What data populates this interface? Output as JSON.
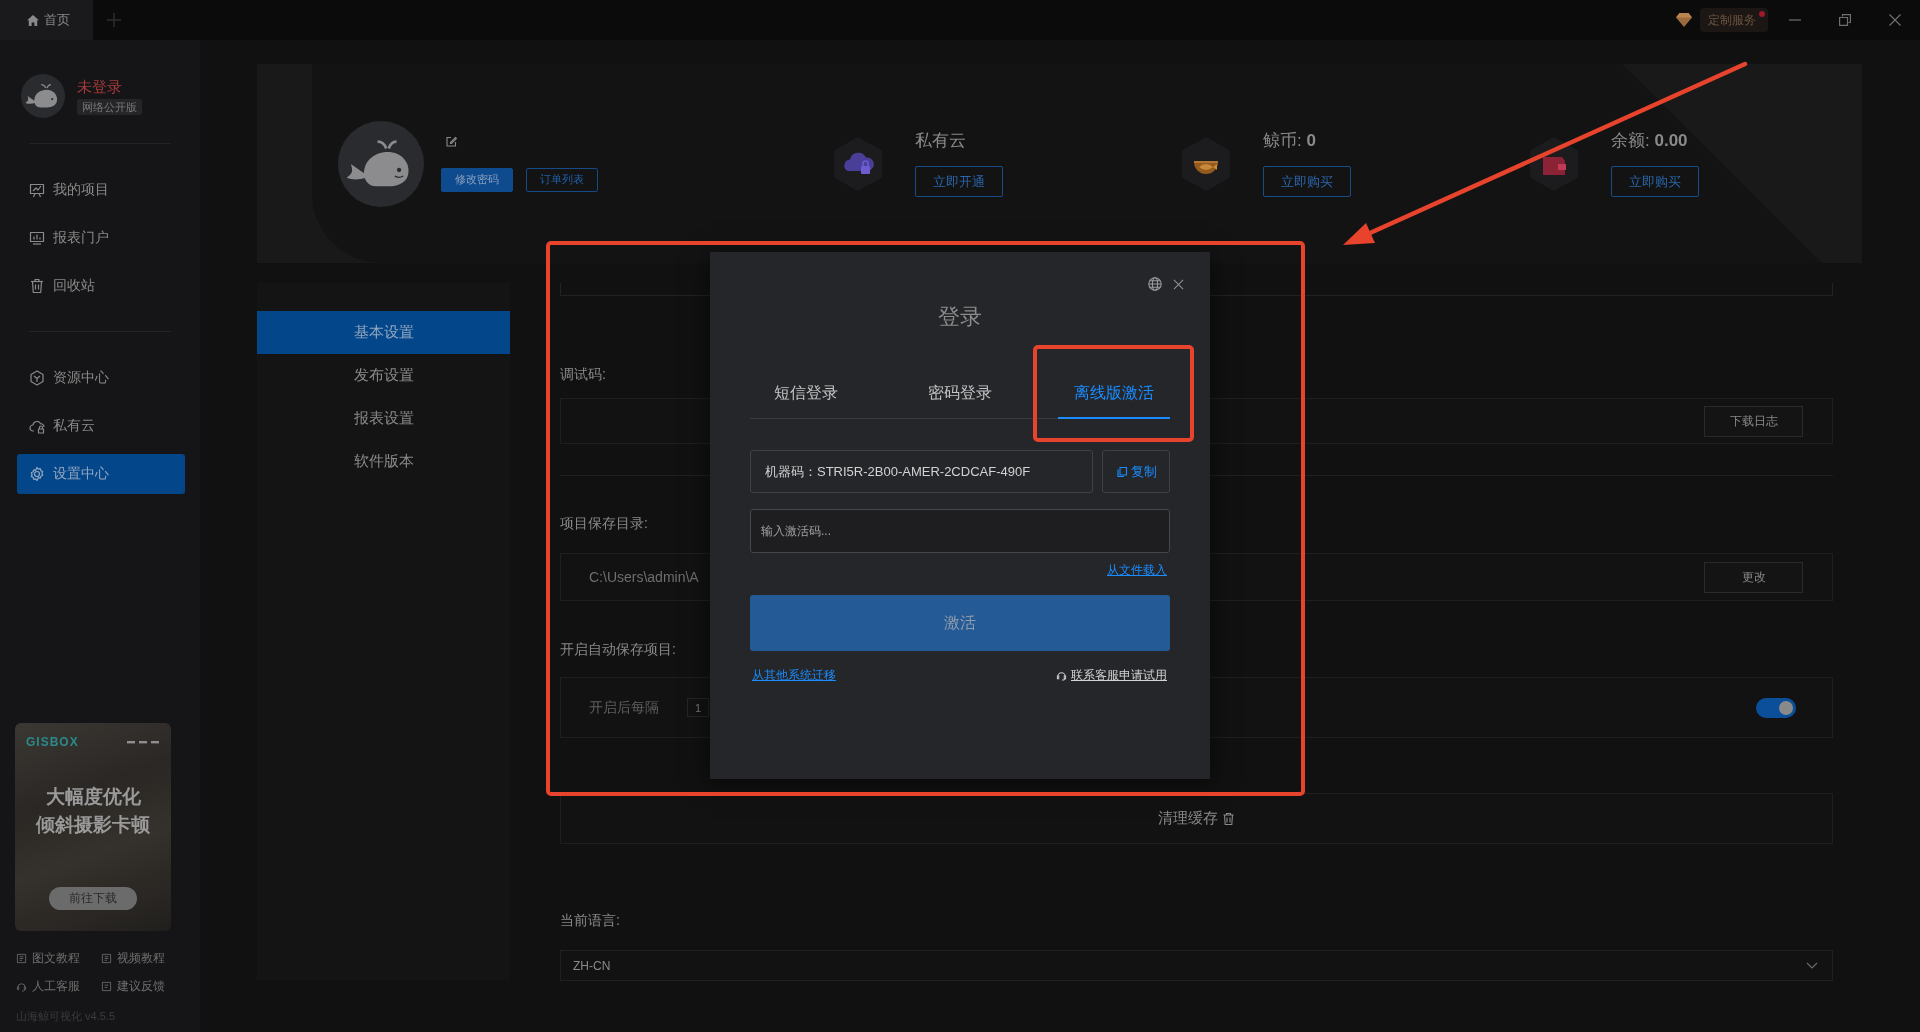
{
  "title_bar": {
    "tabs": [
      {
        "label": "首页",
        "selected": true
      }
    ],
    "service": {
      "label": "定制服务",
      "notification": true
    }
  },
  "sidebar": {
    "user": {
      "status": "未登录",
      "edition": "网络公开版"
    },
    "nav_groups": [
      {
        "items": [
          {
            "label": "我的项目",
            "selected": false
          },
          {
            "label": "报表门户",
            "selected": false
          },
          {
            "label": "回收站",
            "selected": false
          }
        ]
      },
      {
        "items": [
          {
            "label": "资源中心",
            "selected": false
          },
          {
            "label": "私有云",
            "selected": false
          },
          {
            "label": "设置中心",
            "selected": true
          }
        ]
      }
    ],
    "promo": {
      "brand": "GISBOX",
      "headline": [
        "大幅度优化",
        "倾斜摄影卡顿"
      ],
      "button": "前往下载"
    },
    "help_links": [
      "图文教程",
      "视频教程",
      "人工客服",
      "建议反馈"
    ],
    "version": "山海鲸可视化 v4.5.5"
  },
  "profile": {
    "buttons": [
      {
        "label": "修改密码",
        "kind": "primary"
      },
      {
        "label": "订单列表",
        "kind": "outline"
      }
    ],
    "stats": [
      {
        "label": "私有云",
        "button": "立即开通"
      },
      {
        "label": "鲸币: **0**",
        "button": "立即购买"
      },
      {
        "label": "余额: **0.00**",
        "button": "立即购买"
      }
    ]
  },
  "settings_nav": [
    {
      "label": "基本设置",
      "selected": true
    },
    {
      "label": "发布设置",
      "selected": false
    },
    {
      "label": "报表设置",
      "selected": false
    },
    {
      "label": "软件版本",
      "selected": false
    }
  ],
  "settings": {
    "debug_code": {
      "label": "调试码:",
      "button": "下载日志"
    },
    "save_directory": {
      "label": "项目保存目录:",
      "value": "C:\\Users\\admin\\A",
      "button": "更改"
    },
    "autosave": {
      "label": "开启自动保存项目:",
      "interval_label": "开启后每隔",
      "interval": "1",
      "on": true
    },
    "clear_cache": {
      "label": "清理缓存"
    },
    "language": {
      "label": "当前语言:",
      "value": "ZH-CN"
    }
  },
  "login_dialog": {
    "title": "登录",
    "tabs": [
      {
        "label": "短信登录",
        "selected": false
      },
      {
        "label": "密码登录",
        "selected": false
      },
      {
        "label": "离线版激活",
        "selected": true
      }
    ],
    "machine_code": "机器码：STRI5R-2B00-AMER-2CDCAF-490F",
    "copy_button": "复制",
    "activation_code": {
      "placeholder": "输入激活码..."
    },
    "load_file_link": "从文件载入",
    "activate_button": {
      "label": "激活",
      "disabled": true
    },
    "migrate_link": "从其他系统迁移",
    "support_link": "联系客服申请试用"
  }
}
